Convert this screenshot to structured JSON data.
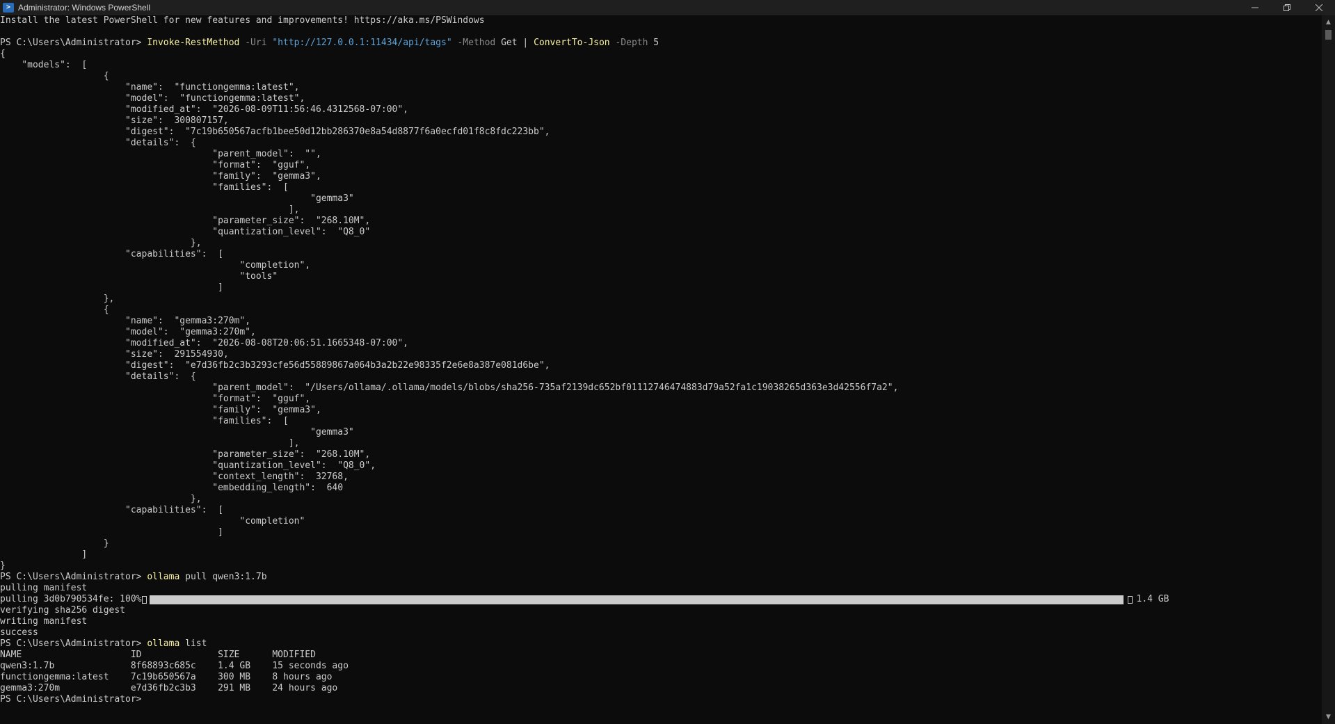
{
  "window": {
    "title": "Administrator: Windows PowerShell",
    "icon": "powershell-icon",
    "controls": {
      "minimize_icon": "minimize-icon",
      "maximize_icon": "restore-icon",
      "close_icon": "close-icon"
    }
  },
  "theme": {
    "background": "#0c0c0c",
    "text": "#cccccc",
    "command": "#f9f1a5",
    "parameter": "#8a8a8a",
    "string": "#5ea3d8"
  },
  "terminal": {
    "banner": "Install the latest PowerShell for new features and improvements! https://aka.ms/PSWindows",
    "prompt": "PS C:\\Users\\Administrator>",
    "command1": {
      "cmdlet": "Invoke-RestMethod",
      "uri_param": "-Uri",
      "uri_value": "\"http://127.0.0.1:11434/api/tags\"",
      "method_param": "-Method",
      "method_value": "Get",
      "pipe": "|",
      "convert": "ConvertTo-Json",
      "depth_param": "-Depth",
      "depth_value": "5"
    },
    "json_output": [
      "{",
      "    \"models\":  [",
      "                   {",
      "                       \"name\":  \"functiongemma:latest\",",
      "                       \"model\":  \"functiongemma:latest\",",
      "                       \"modified_at\":  \"2026-08-09T11:56:46.4312568-07:00\",",
      "                       \"size\":  300807157,",
      "                       \"digest\":  \"7c19b650567acfb1bee50d12bb286370e8a54d8877f6a0ecfd01f8c8fdc223bb\",",
      "                       \"details\":  {",
      "                                       \"parent_model\":  \"\",",
      "                                       \"format\":  \"gguf\",",
      "                                       \"family\":  \"gemma3\",",
      "                                       \"families\":  [",
      "                                                         \"gemma3\"",
      "                                                     ],",
      "                                       \"parameter_size\":  \"268.10M\",",
      "                                       \"quantization_level\":  \"Q8_0\"",
      "                                   },",
      "                       \"capabilities\":  [",
      "                                            \"completion\",",
      "                                            \"tools\"",
      "                                        ]",
      "                   },",
      "                   {",
      "                       \"name\":  \"gemma3:270m\",",
      "                       \"model\":  \"gemma3:270m\",",
      "                       \"modified_at\":  \"2026-08-08T20:06:51.1665348-07:00\",",
      "                       \"size\":  291554930,",
      "                       \"digest\":  \"e7d36fb2c3b3293cfe56d55889867a064b3a2b22e98335f2e6e8a387e081d6be\",",
      "                       \"details\":  {",
      "                                       \"parent_model\":  \"/Users/ollama/.ollama/models/blobs/sha256-735af2139dc652bf01112746474883d79a52fa1c19038265d363e3d42556f7a2\",",
      "                                       \"format\":  \"gguf\",",
      "                                       \"family\":  \"gemma3\",",
      "                                       \"families\":  [",
      "                                                         \"gemma3\"",
      "                                                     ],",
      "                                       \"parameter_size\":  \"268.10M\",",
      "                                       \"quantization_level\":  \"Q8_0\",",
      "                                       \"context_length\":  32768,",
      "                                       \"embedding_length\":  640",
      "                                   },",
      "                       \"capabilities\":  [",
      "                                            \"completion\"",
      "                                        ]",
      "                   }",
      "               ]",
      "}"
    ],
    "command2": {
      "cmd": "ollama",
      "args": "pull qwen3:1.7b"
    },
    "pull_output_before": [
      "pulling manifest"
    ],
    "progress": {
      "label": "pulling 3d0b790534fe: 100%",
      "fraction": 1.0,
      "size": "1.4 GB"
    },
    "pull_output_after": [
      "verifying sha256 digest",
      "writing manifest",
      "success"
    ],
    "command3": {
      "cmd": "ollama",
      "args": "list"
    },
    "list_table": [
      "NAME                    ID              SIZE      MODIFIED",
      "qwen3:1.7b              8f68893c685c    1.4 GB    15 seconds ago",
      "functiongemma:latest    7c19b650567a    300 MB    8 hours ago",
      "gemma3:270m             e7d36fb2c3b3    291 MB    24 hours ago"
    ]
  },
  "scrollbar": {
    "up_icon": "scroll-up-arrow-icon",
    "down_icon": "scroll-down-arrow-icon"
  }
}
